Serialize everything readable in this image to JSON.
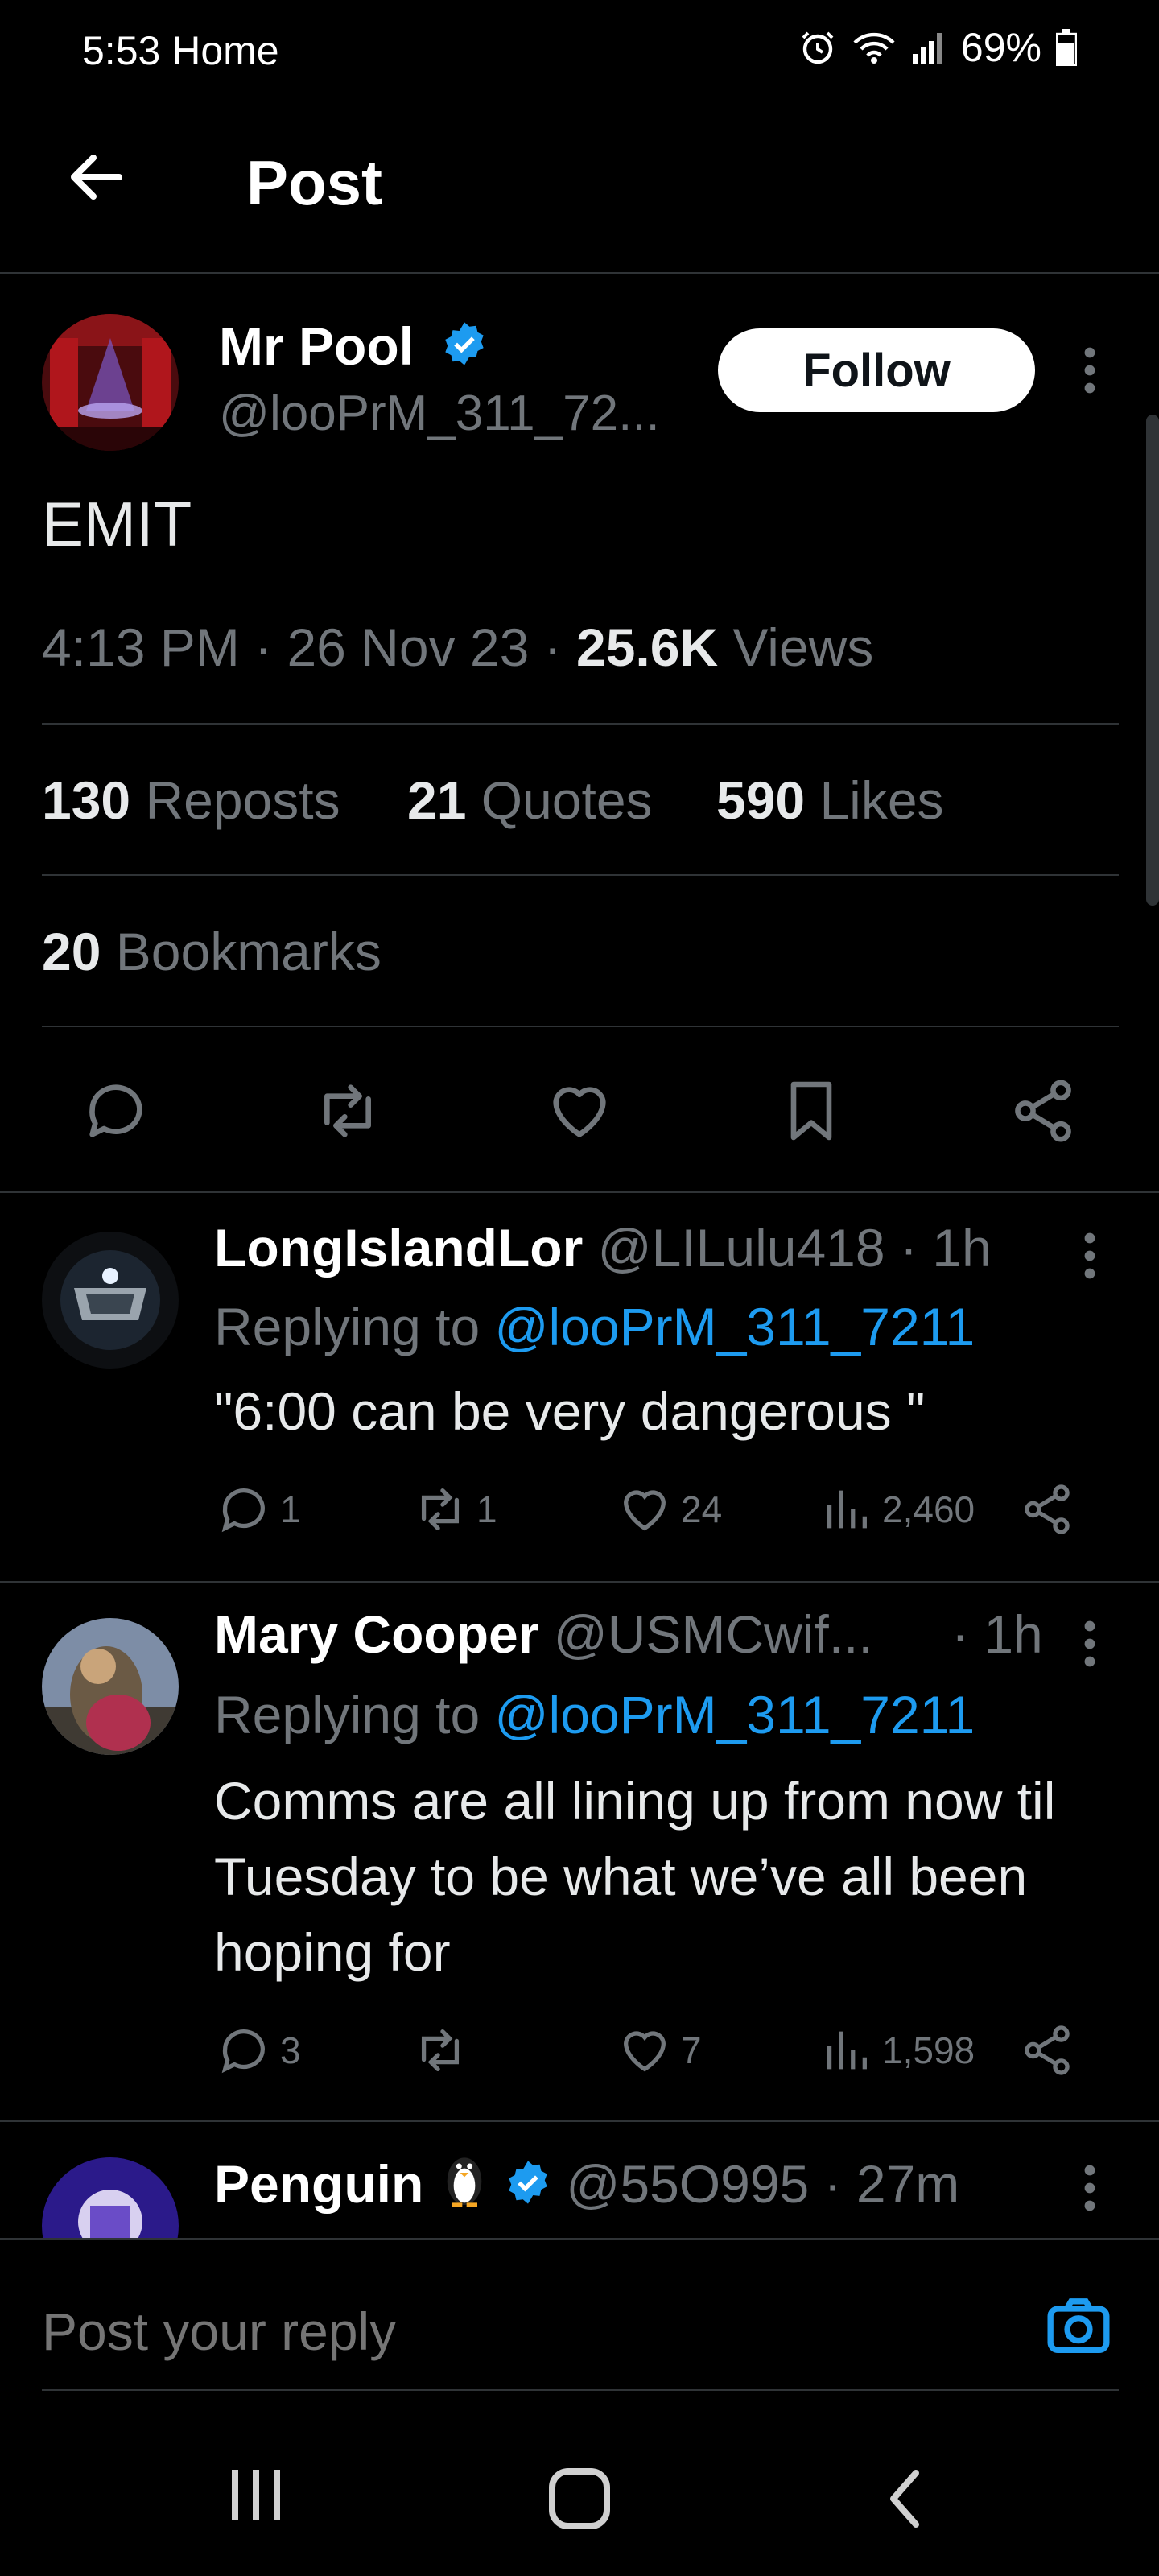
{
  "status_bar": {
    "time_label": "5:53 Home",
    "battery": "69%"
  },
  "header": {
    "title": "Post"
  },
  "post": {
    "author_name": "Mr Pool",
    "author_handle": "@looPrM_311_72...",
    "follow_label": "Follow",
    "text": "EMIT",
    "time": "4:13 PM",
    "date": "26 Nov 23",
    "views_count": "25.6K",
    "views_label": "Views",
    "reposts_count": "130",
    "reposts_label": "Reposts",
    "quotes_count": "21",
    "quotes_label": "Quotes",
    "likes_count": "590",
    "likes_label": "Likes",
    "bookmarks_count": "20",
    "bookmarks_label": "Bookmarks"
  },
  "replies": [
    {
      "name": "LongIslandLor",
      "handle": "@LILulu418",
      "time": "· 1h",
      "replying_prefix": "Replying to",
      "replying_handle": "@looPrM_311_7211",
      "text": "\"6:00 can be very dangerous \"",
      "reply_count": "1",
      "repost_count": "1",
      "like_count": "24",
      "view_count": "2,460"
    },
    {
      "name": "Mary Cooper",
      "handle": "@USMCwif...",
      "time": "· 1h",
      "replying_prefix": "Replying to",
      "replying_handle": "@looPrM_311_7211",
      "text": "Comms are all lining up from now til Tuesday to be what we’ve all been hoping for",
      "reply_count": "3",
      "repost_count": "",
      "like_count": "7",
      "view_count": "1,598"
    },
    {
      "name": "Penguin",
      "handle": "@55O995",
      "time": "· 27m"
    }
  ],
  "composer": {
    "placeholder": "Post your reply"
  },
  "icons": {
    "back": "arrow-left-icon",
    "verified": "verified-badge-icon",
    "reply": "speech-bubble-icon",
    "repost": "repost-icon",
    "like": "heart-icon",
    "bookmark": "bookmark-icon",
    "share": "share-icon",
    "views": "bar-chart-icon",
    "camera": "camera-icon"
  },
  "colors": {
    "accent": "#1d9bf0",
    "muted": "#71767b",
    "background": "#000000",
    "text": "#e7e9ea"
  }
}
